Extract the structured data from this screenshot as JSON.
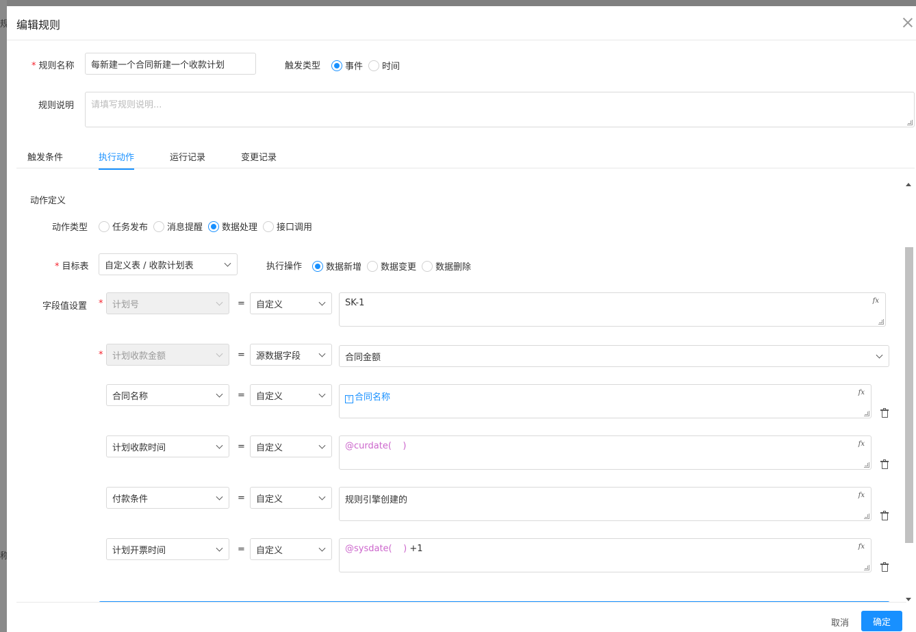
{
  "background": {
    "chars": [
      "规",
      "称"
    ]
  },
  "dialog": {
    "title": "编辑规则",
    "rule_name": {
      "label": "规则名称",
      "value": "每新建一个合同新建一个收款计划"
    },
    "trigger_type": {
      "label": "触发类型",
      "options": [
        "事件",
        "时间"
      ],
      "selected": "事件"
    },
    "rule_desc": {
      "label": "规则说明",
      "placeholder": "请填写规则说明..."
    },
    "tabs": [
      "触发条件",
      "执行动作",
      "运行记录",
      "变更记录"
    ],
    "active_tab": "执行动作",
    "action": {
      "section_title": "动作定义",
      "action_type": {
        "label": "动作类型",
        "options": [
          "任务发布",
          "消息提醒",
          "数据处理",
          "接口调用"
        ],
        "selected": "数据处理"
      },
      "target_table": {
        "label": "目标表",
        "value": "自定义表 / 收款计划表"
      },
      "operation": {
        "label": "执行操作",
        "options": [
          "数据新增",
          "数据变更",
          "数据删除"
        ],
        "selected": "数据新增"
      },
      "field_settings_label": "字段值设置",
      "fields": [
        {
          "field": "计划号",
          "mode": "自定义",
          "value_plain": "SK-1",
          "required": true,
          "disabled": true
        },
        {
          "field": "计划收款金额",
          "mode": "源数据字段",
          "value_plain": "合同金额",
          "required": true,
          "disabled": true
        },
        {
          "field": "合同名称",
          "mode": "自定义",
          "value_tag": "合同名称"
        },
        {
          "field": "计划收款时间",
          "mode": "自定义",
          "value_func": "@curdate(    )"
        },
        {
          "field": "付款条件",
          "mode": "自定义",
          "value_plain": "规则引擎创建的"
        },
        {
          "field": "计划开票时间",
          "mode": "自定义",
          "value_func": "@sysdate(    )",
          "value_suffix": " +1"
        }
      ],
      "equals": "=",
      "fx": "fx"
    },
    "footer": {
      "cancel": "取消",
      "ok": "确定"
    }
  },
  "colors": {
    "primary": "#1890ff",
    "required": "#f5222d",
    "func": "#cc66cc"
  }
}
